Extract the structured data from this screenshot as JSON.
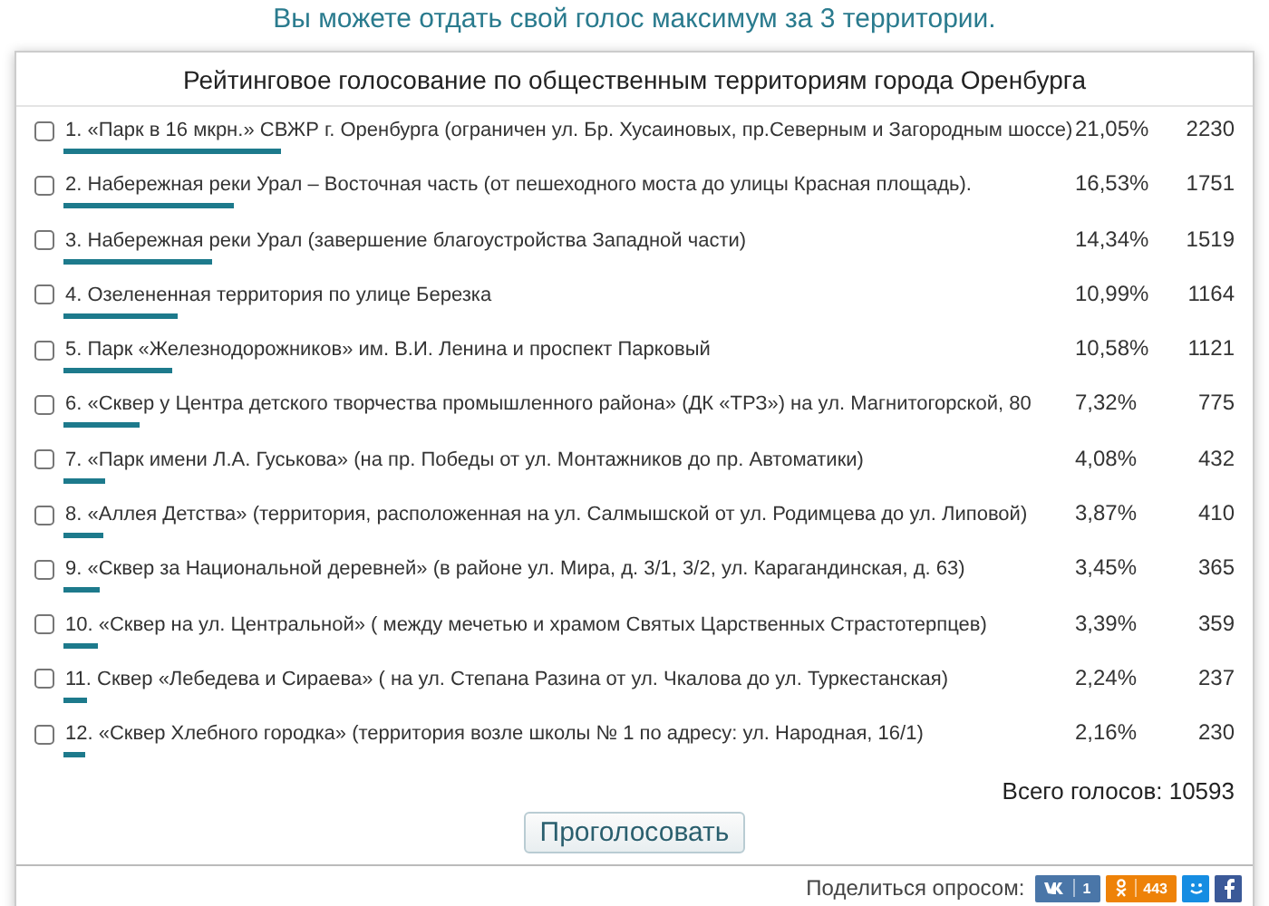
{
  "notice": "Вы можете отдать свой голос максимум за 3 территории.",
  "poll": {
    "title": "Рейтинговое голосование по общественным территориям города Оренбурга",
    "options": [
      {
        "number": "1.",
        "name": "«Парк в 16 мкрн.»",
        "rest": "СВЖР г. Оренбурга (ограничен ул. Бр. Хусаиновых, пр.Северным и Загородным шоссе)",
        "percent": "21,05%",
        "votes": "2230",
        "checked": false
      },
      {
        "number": "2.",
        "name": "Набережная реки Урал",
        "rest": "– Восточная часть (от пешеходного моста до улицы Красная площадь).",
        "percent": "16,53%",
        "votes": "1751",
        "checked": false
      },
      {
        "number": "3.",
        "name": "Набережная реки Урал",
        "rest": "(завершение благоустройства Западной части)",
        "percent": "14,34%",
        "votes": "1519",
        "checked": false
      },
      {
        "number": "4.",
        "name": "Озелененная территория",
        "rest": "по улице Березка",
        "percent": "10,99%",
        "votes": "1164",
        "checked": false
      },
      {
        "number": "5.",
        "name": "Парк «Железнодорожников»",
        "rest": "им. В.И. Ленина и проспект Парковый",
        "percent": "10,58%",
        "votes": "1121",
        "checked": false
      },
      {
        "number": "6.",
        "name": "«Сквер у Центра детского творчества промышленного района»",
        "rest": "(ДК «ТРЗ») на ул. Магнитогорской, 80",
        "percent": "7,32%",
        "votes": "775",
        "checked": false
      },
      {
        "number": "7.",
        "name": "«Парк имени Л.А. Гуськова»",
        "rest": "(на пр. Победы от ул. Монтажников до пр. Автоматики)",
        "percent": "4,08%",
        "votes": "432",
        "checked": false
      },
      {
        "number": "8.",
        "name": "«Аллея Детства»",
        "rest": "(территория, расположенная на ул. Салмышской от ул. Родимцева до ул. Липовой)",
        "percent": "3,87%",
        "votes": "410",
        "checked": false
      },
      {
        "number": "9.",
        "name": "«Сквер за Национальной деревней»",
        "rest": "(в районе ул. Мира, д. 3/1, 3/2, ул. Карагандинская, д. 63)",
        "percent": "3,45%",
        "votes": "365",
        "checked": false
      },
      {
        "number": "10.",
        "name": "«Сквер на ул. Центральной»",
        "rest": "( между мечетью и храмом Святых Царственных Страстотерпцев)",
        "percent": "3,39%",
        "votes": "359",
        "checked": false
      },
      {
        "number": "11.",
        "name": "Сквер «Лебедева и Сираева»",
        "rest": "( на ул. Степана Разина от ул. Чкалова до ул. Туркестанская)",
        "percent": "2,24%",
        "votes": "237",
        "checked": false
      },
      {
        "number": "12.",
        "name": "«Сквер Хлебного городка»",
        "rest": "(территория возле школы № 1 по адресу: ул. Народная, 16/1)",
        "percent": "2,16%",
        "votes": "230",
        "checked": false
      }
    ],
    "total": "Всего голосов: 10593",
    "vote_button": "Проголосовать"
  },
  "share": {
    "label": "Поделиться опросом:",
    "buttons": [
      {
        "kind": "vk",
        "count": "1"
      },
      {
        "kind": "ok",
        "count": "443"
      },
      {
        "kind": "mail"
      },
      {
        "kind": "facebook"
      }
    ]
  }
}
